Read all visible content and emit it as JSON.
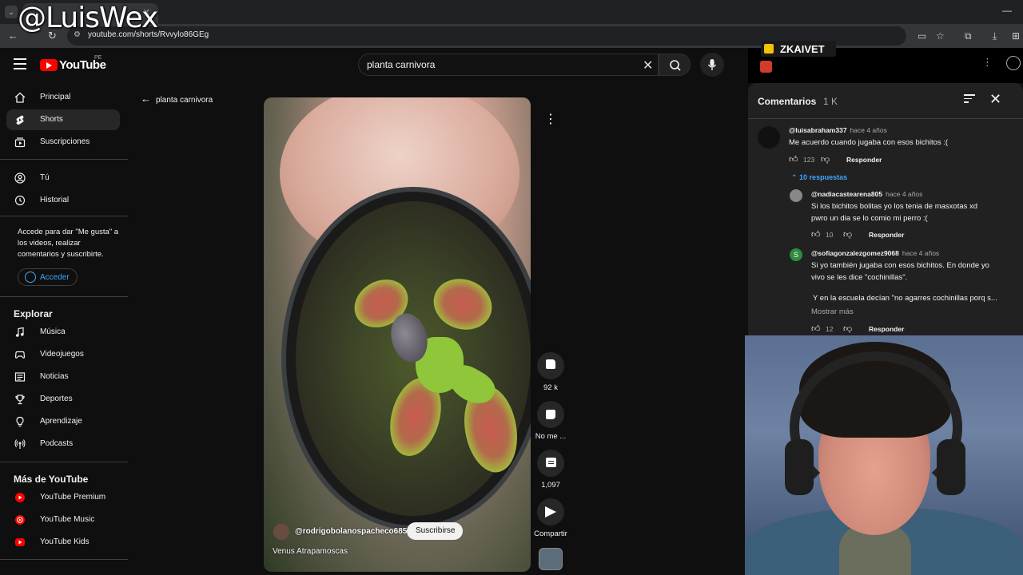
{
  "overlay": {
    "watermark": "@LuisWex",
    "badge_name": "ZKAIVET"
  },
  "browser": {
    "url": "youtube.com/shorts/Rvvylo86GEg"
  },
  "header": {
    "logo": "YouTube",
    "region": "PE",
    "search_value": "planta carnivora"
  },
  "sidebar": {
    "primary": [
      {
        "label": "Principal",
        "icon": "home-icon"
      },
      {
        "label": "Shorts",
        "icon": "shorts-icon"
      },
      {
        "label": "Suscripciones",
        "icon": "subscriptions-icon"
      }
    ],
    "you": [
      {
        "label": "Tú",
        "icon": "user-icon"
      },
      {
        "label": "Historial",
        "icon": "history-icon"
      }
    ],
    "signin_note": "Accede para dar \"Me gusta\" a los videos, realizar comentarios y suscribirte.",
    "signin_label": "Acceder",
    "explore_heading": "Explorar",
    "explore": [
      {
        "label": "Música",
        "icon": "music-icon"
      },
      {
        "label": "Videojuegos",
        "icon": "gaming-icon"
      },
      {
        "label": "Noticias",
        "icon": "news-icon"
      },
      {
        "label": "Deportes",
        "icon": "trophy-icon"
      },
      {
        "label": "Aprendizaje",
        "icon": "lightbulb-icon"
      },
      {
        "label": "Podcasts",
        "icon": "podcast-icon"
      }
    ],
    "more_heading": "Más de YouTube",
    "more": [
      {
        "label": "YouTube Premium"
      },
      {
        "label": "YouTube Music"
      },
      {
        "label": "YouTube Kids"
      }
    ]
  },
  "short": {
    "back_label": "planta carnivora",
    "channel": "@rodrigobolanospacheco6858",
    "subscribe": "Suscribirse",
    "caption": "Venus Atrapamoscas",
    "likes": "92 k",
    "dislike_label": "No me ...",
    "comments": "1,097",
    "share_label": "Compartir"
  },
  "comments": {
    "title": "Comentarios",
    "count": "1 K",
    "reply_label": "Responder",
    "replies_toggle": "10 respuestas",
    "show_more": "Mostrar más",
    "items": [
      {
        "author": "@luisabraham337",
        "time": "hace 4 años",
        "text": "Me acuerdo cuando jugaba con esos bichitos :(",
        "likes": "123"
      },
      {
        "author": "@nadiacastearena805",
        "time": "hace 4 años",
        "text": "Si los bichitos bolitas yo los tenia de masxotas xd pwro un dia se lo comio mi perro :(",
        "likes": "10"
      },
      {
        "author": "@sofiagonzalezgomez9068",
        "time": "hace 4 años",
        "text": "Si yo también jugaba con esos bichitos. En donde yo vivo se les dice \"cochinillas\".",
        "text2": "Y en la escuela decían \"no agarres cochinillas porq s...",
        "likes": "12",
        "avatar_letter": "S"
      }
    ]
  },
  "colors": {
    "accent": "#3ea6ff",
    "brand": "#ff0000",
    "background": "#0f0f0f",
    "panel": "#212121"
  }
}
